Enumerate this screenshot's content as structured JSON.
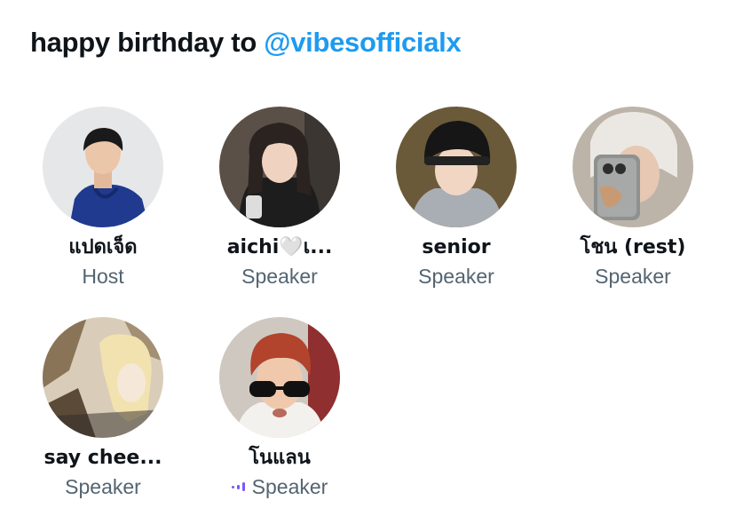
{
  "space": {
    "title_prefix": "happy birthday to ",
    "title_mention": "@vibesofficialx"
  },
  "participants": [
    {
      "name": "แปดเจ็ด",
      "role": "Host",
      "avatar": "person-blue-hoodie"
    },
    {
      "name": "aichi🤍เ...",
      "role": "Speaker",
      "avatar": "person-long-hair"
    },
    {
      "name": "senior",
      "role": "Speaker",
      "avatar": "person-beanie"
    },
    {
      "name": "โชน (rest)",
      "role": "Speaker",
      "avatar": "person-mirror-selfie"
    },
    {
      "name": "say chee...",
      "role": "Speaker",
      "avatar": "tobe-vibes-artwork"
    },
    {
      "name": "โนแลน",
      "role": "Speaker",
      "avatar": "person-red-hair-sunglasses",
      "speaking": true
    }
  ],
  "colors": {
    "mention": "#1d9bf0",
    "role_text": "#536471",
    "speaking_indicator": "#7856ff"
  }
}
